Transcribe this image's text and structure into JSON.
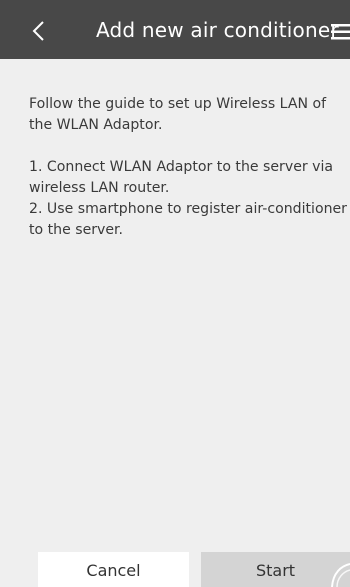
{
  "header": {
    "title": "Add new air conditioner",
    "back_icon": "chevron-left-icon",
    "menu_icon": "hamburger-menu-icon"
  },
  "guide": {
    "intro": "Follow the guide to set up Wireless LAN of the WLAN Adaptor.",
    "steps": [
      "1. Connect WLAN Adaptor to the server via wireless LAN router.",
      "2. Use smartphone to register air-conditioner to the server."
    ]
  },
  "footer": {
    "cancel_label": "Cancel",
    "start_label": "Start"
  },
  "colors": {
    "header_bg": "#484848",
    "page_bg": "#efefef",
    "start_bg": "#d4d4d4",
    "cancel_bg": "#ffffff"
  }
}
